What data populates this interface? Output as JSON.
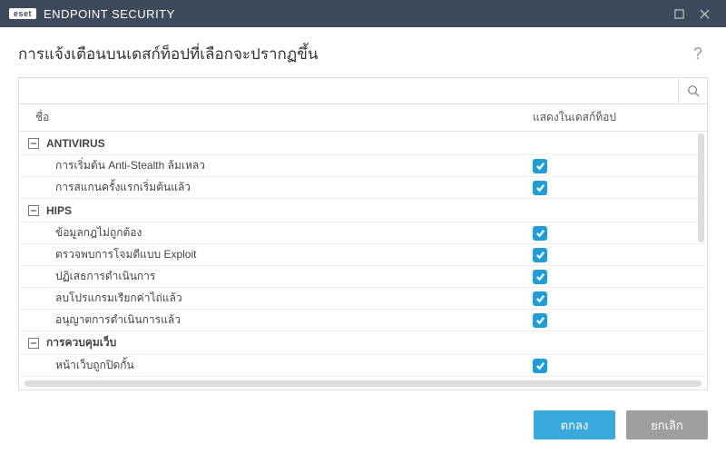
{
  "titlebar": {
    "logo": "eset",
    "product": "ENDPOINT SECURITY"
  },
  "page_title": "การแจ้งเตือนบนเดสก์ท็อปที่เลือกจะปรากฏขึ้น",
  "columns": {
    "name": "ชื่อ",
    "show": "แสดงในเดสก์ท็อป"
  },
  "groups": [
    {
      "label": "ANTIVIRUS",
      "items": [
        {
          "label": "การเริ่มต้น Anti-Stealth ล้มเหลว",
          "checked": true
        },
        {
          "label": "การสแกนครั้งแรกเริ่มต้นแล้ว",
          "checked": true
        }
      ]
    },
    {
      "label": "HIPS",
      "items": [
        {
          "label": "ข้อมูลกฎไม่ถูกต้อง",
          "checked": true
        },
        {
          "label": "ตรวจพบการโจมตีแบบ Exploit",
          "checked": true
        },
        {
          "label": "ปฏิเสธการดำเนินการ",
          "checked": true
        },
        {
          "label": "ลบโปรแกรมเรียกค่าไถ่แล้ว",
          "checked": true
        },
        {
          "label": "อนุญาตการดำเนินการแล้ว",
          "checked": true
        }
      ]
    },
    {
      "label": "การควบคุมเว็บ",
      "items": [
        {
          "label": "หน้าเว็บถูกปิดกั้น",
          "checked": true
        }
      ]
    }
  ],
  "buttons": {
    "ok": "ตกลง",
    "cancel": "ยกเลิก"
  }
}
